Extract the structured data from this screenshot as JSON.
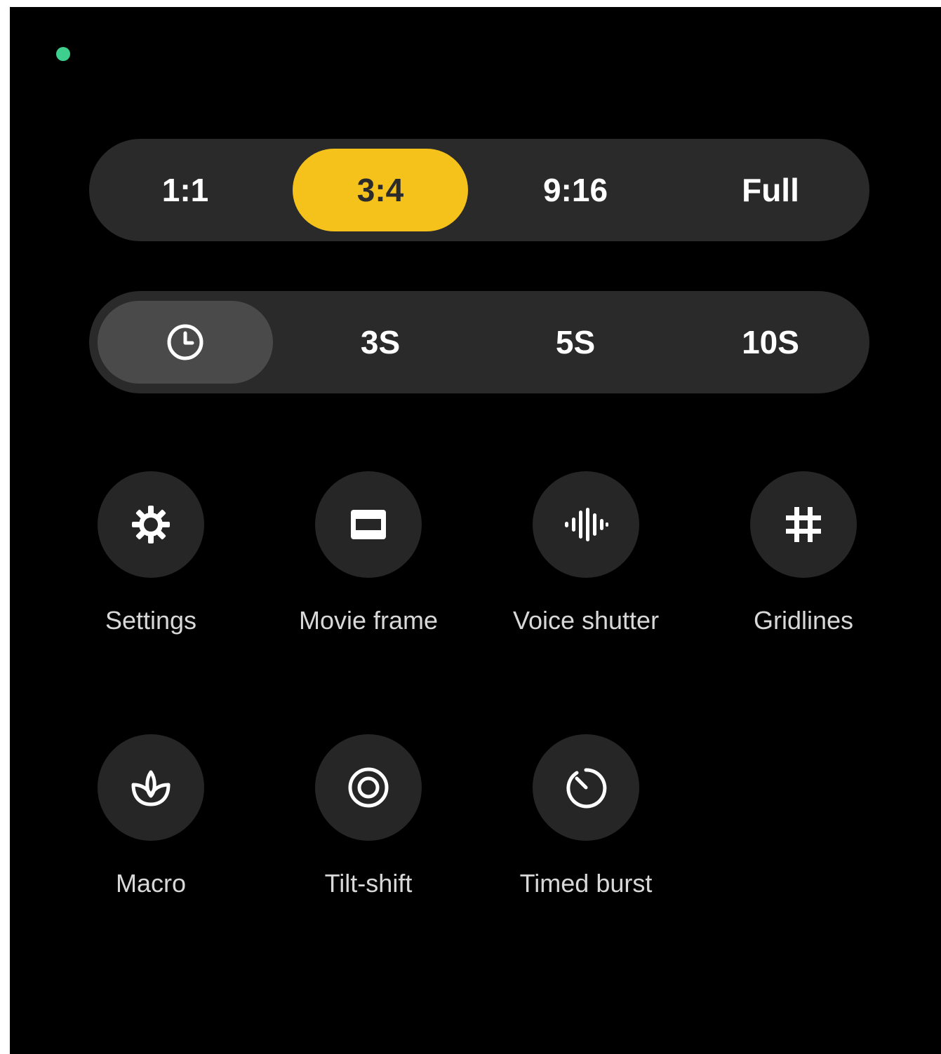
{
  "aspect_ratio": {
    "options": [
      "1:1",
      "3:4",
      "9:16",
      "Full"
    ],
    "selected": "3:4"
  },
  "timer": {
    "icon": "clock-icon",
    "options": [
      "3S",
      "5S",
      "10S"
    ],
    "selected": "off"
  },
  "tools": [
    {
      "label": "Settings",
      "icon": "gear-icon"
    },
    {
      "label": "Movie frame",
      "icon": "movie-frame-icon"
    },
    {
      "label": "Voice shutter",
      "icon": "soundwave-icon"
    },
    {
      "label": "Gridlines",
      "icon": "grid-icon"
    },
    {
      "label": "Macro",
      "icon": "flower-icon"
    },
    {
      "label": "Tilt-shift",
      "icon": "tilt-shift-icon"
    },
    {
      "label": "Timed burst",
      "icon": "timed-burst-icon"
    }
  ],
  "colors": {
    "accent": "#f4c21a",
    "status_dot": "#3ecf8e",
    "panel": "#2a2a2a",
    "background": "#000000"
  }
}
